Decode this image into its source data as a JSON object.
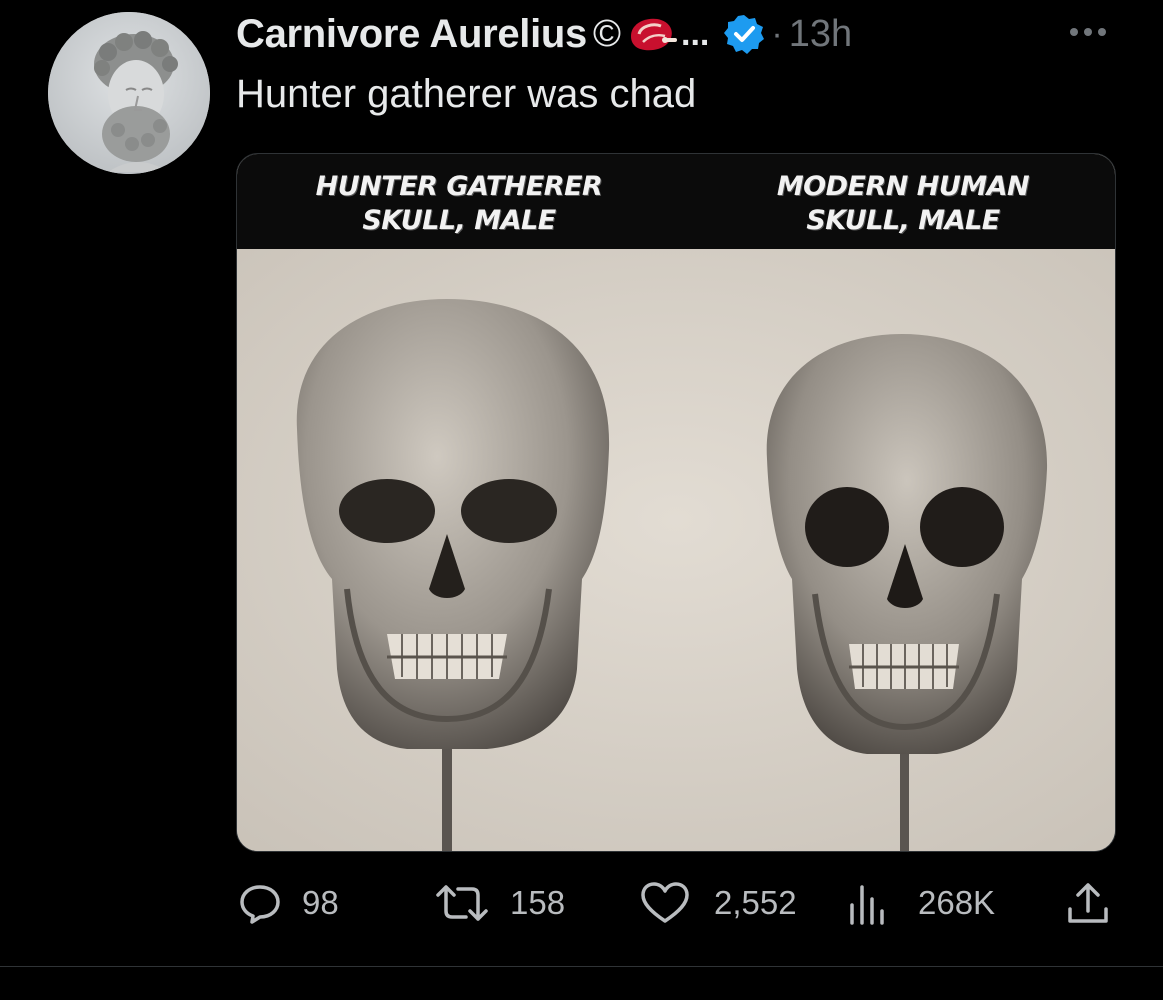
{
  "user": {
    "display_name": "Carnivore Aurelius",
    "copyright_symbol": "©",
    "truncation": "...",
    "separator": "·",
    "time": "13h",
    "avatar_icon": "marcus-aurelius-bust-avatar",
    "verified_color": "#1d9bf0"
  },
  "tweet": {
    "text": "Hunter gatherer was chad"
  },
  "media": {
    "left_caption_line1": "HUNTER GATHERER",
    "left_caption_line2": "SKULL, MALE",
    "right_caption_line1": "MODERN HUMAN",
    "right_caption_line2": "SKULL, MALE"
  },
  "actions": {
    "reply_count": "98",
    "retweet_count": "158",
    "like_count": "2,552",
    "views_count": "268K",
    "icons": [
      "reply-icon",
      "retweet-icon",
      "like-icon",
      "views-icon",
      "share-icon"
    ]
  }
}
